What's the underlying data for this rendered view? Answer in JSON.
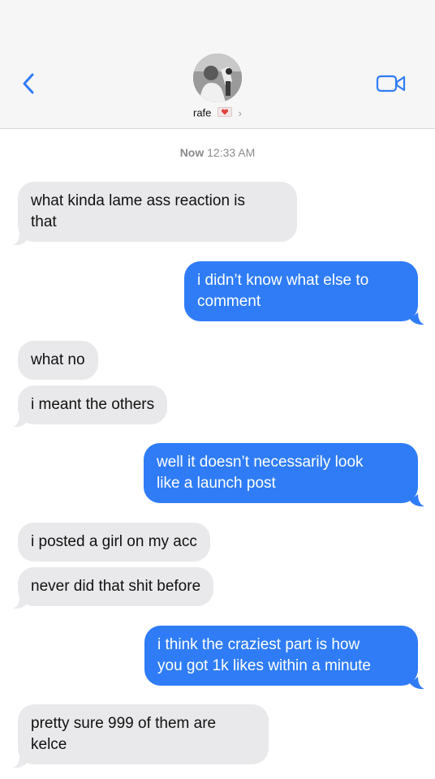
{
  "header": {
    "contact_name": "rafe",
    "chevron": "›",
    "icons": {
      "back": "chevron-left-icon",
      "video": "video-camera-icon",
      "status": "heart-envelope-icon"
    },
    "colors": {
      "accent": "#2f7cf6",
      "incoming": "#e9e9eb",
      "heart": "#e0453f"
    }
  },
  "timestamp": {
    "day": "Now",
    "time": "12:33 AM"
  },
  "messages": [
    {
      "direction": "incoming",
      "line1": "what kinda lame ass reaction is",
      "line2": "that"
    },
    {
      "direction": "outgoing",
      "line1": "i didn’t know what else to",
      "line2": "comment"
    },
    {
      "direction": "incoming",
      "line1": "what no"
    },
    {
      "direction": "incoming",
      "line1": "i meant the others"
    },
    {
      "direction": "outgoing",
      "line1": "well it doesn’t necessarily look",
      "line2": "like a launch post"
    },
    {
      "direction": "incoming",
      "line1": "i posted a girl on my acc"
    },
    {
      "direction": "incoming",
      "line1": "never did that shit before"
    },
    {
      "direction": "outgoing",
      "line1": "i think the craziest part is how",
      "line2": "you got 1k likes within a minute"
    },
    {
      "direction": "incoming",
      "line1": "pretty sure 999 of them are",
      "line2": "kelce"
    }
  ]
}
